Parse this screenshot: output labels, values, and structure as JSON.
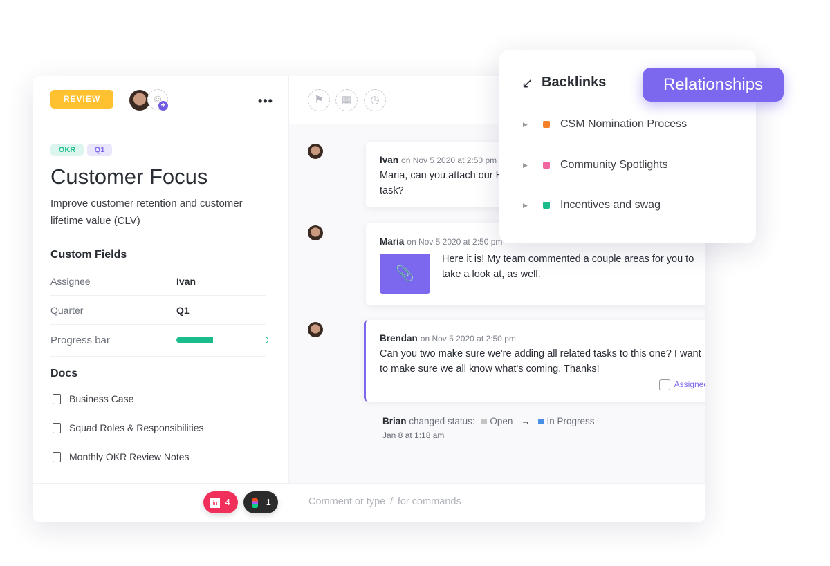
{
  "task": {
    "status": "REVIEW",
    "tags": [
      "OKR",
      "Q1"
    ],
    "title": "Customer Focus",
    "description": "Improve customer retention and customer lifetime value (CLV)",
    "custom_fields_title": "Custom Fields",
    "fields": [
      {
        "label": "Assignee",
        "value": "Ivan"
      },
      {
        "label": "Quarter",
        "value": "Q1"
      },
      {
        "label": "Progress bar",
        "progress": 0.4
      }
    ],
    "docs_title": "Docs",
    "docs": [
      "Business Case",
      "Squad Roles & Responsibilities",
      "Monthly OKR Review Notes"
    ],
    "integrations": [
      {
        "name": "InVision",
        "count": "4",
        "color": "#f0305a"
      },
      {
        "name": "Figma",
        "count": "1",
        "color": "#2b2b2b"
      }
    ]
  },
  "comments": [
    {
      "author": "Ivan",
      "time": "on Nov 5 2020 at 2:50 pm",
      "text": "Maria, can you attach our H1 Pl the task?"
    },
    {
      "author": "Maria",
      "time": "on Nov 5 2020 at 2:50 pm",
      "text": "Here it is! My team commented a couple areas for you to take a look at, as well."
    },
    {
      "author": "Brendan",
      "time": "on Nov 5 2020 at 2:50 pm",
      "text": "Can you two make sure we're adding all related tasks to this one? I want to make sure we all know what's coming. Thanks!",
      "assigned_label": "Assigned"
    }
  ],
  "activity": {
    "author": "Brian",
    "action": "changed status:",
    "from": "Open",
    "to": "In Progress",
    "time": "Jan 8 at 1:18 am",
    "from_color": "#c4c4c4",
    "to_color": "#4a8fe7"
  },
  "comment_placeholder": "Comment or type '/' for commands",
  "backlinks": {
    "title": "Backlinks",
    "items": [
      {
        "label": "CSM Nomination Process",
        "color": "#f5802a"
      },
      {
        "label": "Community Spotlights",
        "color": "#f2679f"
      },
      {
        "label": "Incentives and swag",
        "color": "#1bbc8c"
      }
    ]
  },
  "relationships_label": "Relationships",
  "accent": "#7b68ee"
}
